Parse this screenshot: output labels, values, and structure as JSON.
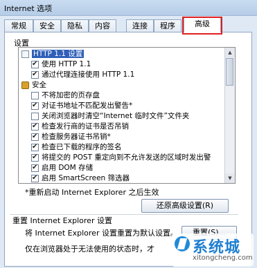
{
  "window": {
    "title": "Internet 选项"
  },
  "tabs": [
    {
      "label": "常规"
    },
    {
      "label": "安全"
    },
    {
      "label": "隐私"
    },
    {
      "label": "内容"
    },
    {
      "label": "连接"
    },
    {
      "label": "程序"
    },
    {
      "label": "高级"
    }
  ],
  "active_tab": "高级",
  "settings": {
    "label": "设置",
    "items": [
      {
        "text": "HTTP 1.1 设置",
        "type": "doc",
        "selected": true
      },
      {
        "text": "使用 HTTP 1.1",
        "type": "checkbox",
        "checked": true
      },
      {
        "text": "通过代理连接使用 HTTP 1.1",
        "type": "checkbox",
        "checked": true
      },
      {
        "text": "安全",
        "type": "lock"
      },
      {
        "text": "不将加密的页存盘",
        "type": "checkbox",
        "checked": false
      },
      {
        "text": "对证书地址不匹配发出警告*",
        "type": "checkbox",
        "checked": true
      },
      {
        "text": "关闭浏览器时清空“Internet 临时文件”文件夹",
        "type": "checkbox",
        "checked": false
      },
      {
        "text": "检查发行商的证书是否吊销",
        "type": "checkbox",
        "checked": true
      },
      {
        "text": "检查服务器证书吊销*",
        "type": "checkbox",
        "checked": true
      },
      {
        "text": "检查已下载的程序的签名",
        "type": "checkbox",
        "checked": true
      },
      {
        "text": "将提交的 POST 重定向到不允许发送的区域时发出警",
        "type": "checkbox",
        "checked": true
      },
      {
        "text": "启用 DOM 存储",
        "type": "checkbox",
        "checked": true
      },
      {
        "text": "启用 SmartScreen 筛选器",
        "type": "checkbox",
        "checked": true
      }
    ],
    "restart_note": "*重新启动 Internet Explorer 之后生效",
    "restore_button": "还原高级设置(R)"
  },
  "reset": {
    "heading": "重置 Internet Explorer 设置",
    "description": "将 Internet Explorer 设置重置为默认设置。",
    "button": "重置(S)...",
    "note": "仅在浏览器处于无法使用的状态时，才"
  },
  "watermark": {
    "brand": "系统城",
    "url": "xitongcheng.com"
  }
}
